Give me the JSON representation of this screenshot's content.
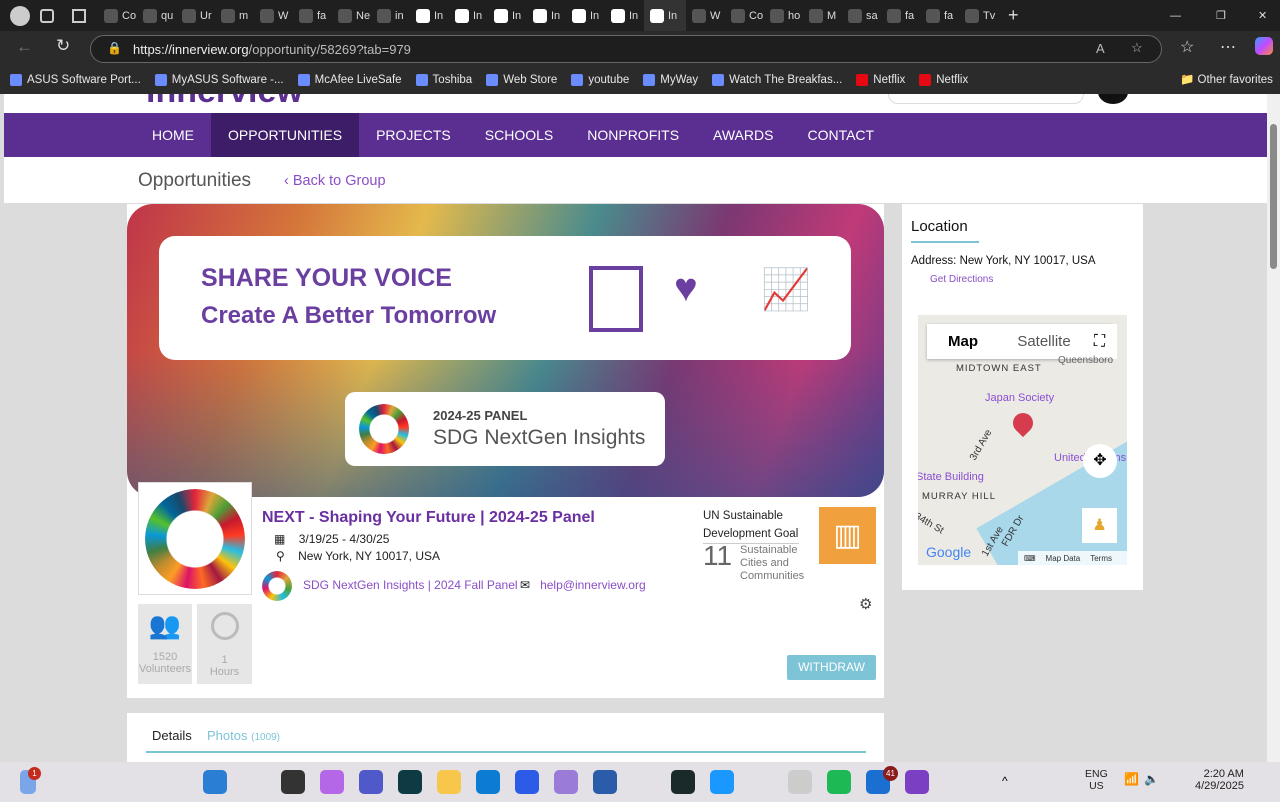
{
  "browser": {
    "tabs": [
      "Co",
      "qu",
      "Ur",
      "m",
      "W",
      "fa",
      "Ne",
      "in",
      "In",
      "In",
      "In",
      "In",
      "In",
      "In",
      "In",
      "W",
      "Co",
      "ho",
      "M",
      "sa",
      "fa",
      "fa",
      "Tv"
    ],
    "active_tab": "In",
    "url_host": "https://innerview.org",
    "url_path": "/opportunity/58269?tab=979",
    "bookmarks": [
      "ASUS Software Port...",
      "MyASUS Software -...",
      "McAfee LiveSafe",
      "Toshiba",
      "Web Store",
      "youtube",
      "MyWay",
      "Watch The Breakfas...",
      "Netflix",
      "Netflix"
    ],
    "other_favorites": "Other favorites"
  },
  "site": {
    "logo": "innerview",
    "nav": [
      "HOME",
      "OPPORTUNITIES",
      "PROJECTS",
      "SCHOOLS",
      "NONPROFITS",
      "AWARDS",
      "CONTACT"
    ],
    "section_title": "Opportunities",
    "back_link": "‹ Back to Group",
    "banner": {
      "line1": "SHARE YOUR VOICE",
      "line2": "Create A Better Tomorrow",
      "panel_year": "2024-25  PANEL",
      "panel_name": "SDG NextGen Insights"
    },
    "opportunity": {
      "title": "NEXT - Shaping Your Future | 2024-25 Panel",
      "dates": "3/19/25 - 4/30/25",
      "location": "New York, NY 10017, USA",
      "group": "SDG NextGen Insights | 2024 Fall Panel",
      "email": "help@innerview.org",
      "volunteers_count": "1520",
      "volunteers_label": "Volunteers",
      "hours_count": "1",
      "hours_label": "Hours",
      "sdg_heading": "UN Sustainable Development Goal",
      "sdg_number": "11",
      "sdg_name": "Sustainable Cities and Communities",
      "withdraw": "WITHDRAW"
    },
    "tabs": {
      "details": "Details",
      "photos": "Photos",
      "photos_count": "(1009)"
    },
    "location": {
      "heading": "Location",
      "address": "Address: New York, NY 10017, USA",
      "directions": "Get Directions",
      "map": {
        "map_btn": "Map",
        "satellite_btn": "Satellite",
        "labels": [
          "MIDTOWN EAST",
          "Japan Society",
          "State Building",
          "MURRAY HILL",
          "Queensboro",
          "United Nations Headquarters",
          "3rd Ave",
          "1st Ave",
          "FDR Dr",
          "34th St"
        ],
        "map_data": "Map Data",
        "terms": "Terms",
        "google": "Google"
      }
    }
  },
  "taskbar": {
    "lang": "ENG",
    "region": "US",
    "time": "2:20 AM",
    "date": "4/29/2025",
    "teams_badge": "41",
    "weather_badge": "1"
  }
}
